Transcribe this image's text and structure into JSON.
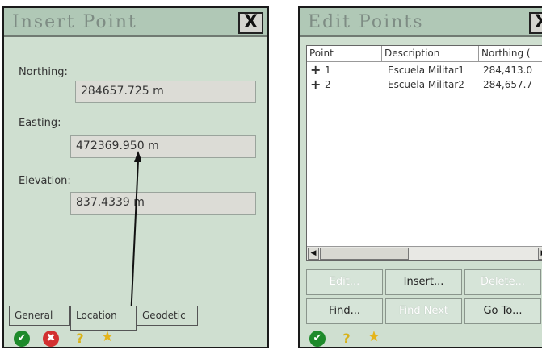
{
  "insert_point": {
    "title": "Insert Point",
    "close_label": "X",
    "fields": [
      {
        "label": "Northing:",
        "value": "284657.725 m"
      },
      {
        "label": "Easting:",
        "value": "472369.950 m"
      },
      {
        "label": "Elevation:",
        "value": "837.4339 m"
      }
    ],
    "tabs": [
      "General",
      "Location",
      "Geodetic"
    ],
    "active_tab": "Location",
    "toolbar_icons": [
      "ok-icon",
      "cancel-icon",
      "help-icon",
      "star-icon"
    ]
  },
  "edit_points": {
    "title": "Edit Points",
    "close_label": "X",
    "columns": [
      "Point",
      "Description",
      "Northing ("
    ],
    "rows": [
      {
        "marker": "+",
        "point": "1",
        "description": "Escuela Militar1",
        "northing": "284,413.0"
      },
      {
        "marker": "+",
        "point": "2",
        "description": "Escuela Militar2",
        "northing": "284,657.7"
      }
    ],
    "buttons_row1": [
      {
        "label": "Edit...",
        "enabled": false
      },
      {
        "label": "Insert...",
        "enabled": true
      },
      {
        "label": "Delete...",
        "enabled": false
      }
    ],
    "buttons_row2": [
      {
        "label": "Find...",
        "enabled": true
      },
      {
        "label": "Find Next",
        "enabled": false
      },
      {
        "label": "Go To...",
        "enabled": true
      }
    ],
    "toolbar_icons": [
      "cancel-icon",
      "help-icon",
      "star-icon"
    ]
  }
}
